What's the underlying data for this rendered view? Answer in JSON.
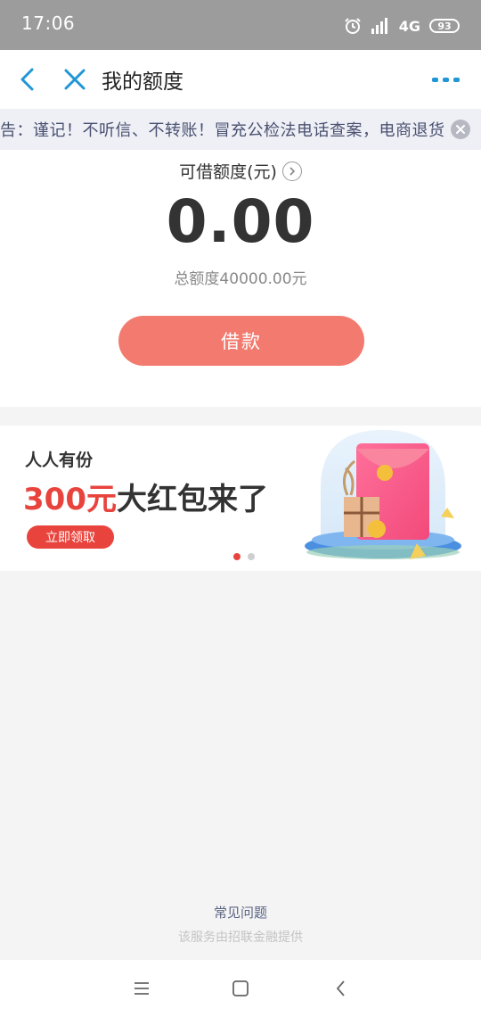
{
  "status_bar": {
    "time": "17:06",
    "network": "4G",
    "battery": "93"
  },
  "nav": {
    "title": "我的额度"
  },
  "notice": {
    "text": "告：谨记！不听信、不转账！冒充公检法电话查案，电商退货退"
  },
  "quota": {
    "label": "可借额度(元)",
    "amount": "0.00",
    "total": "总额度40000.00元",
    "borrow_label": "借款"
  },
  "banner": {
    "subtitle": "人人有份",
    "amount": "300元",
    "headline_rest": "大红包来了",
    "cta_label": "立即领取",
    "active_slide": 1,
    "slide_count": 2
  },
  "footer": {
    "faq": "常见问题",
    "provider": "该服务由招联金融提供"
  },
  "colors": {
    "accent": "#2196d6",
    "button": "#f37a6e",
    "promo_red": "#e8443d"
  }
}
